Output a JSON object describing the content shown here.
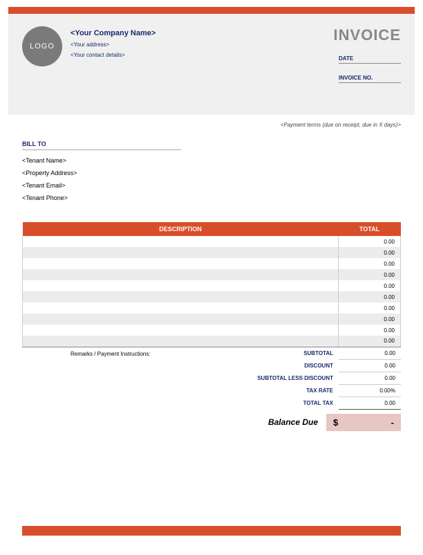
{
  "colors": {
    "accent": "#d94e2a",
    "dark_blue": "#172a6b",
    "balance_bg": "#e8c6c3"
  },
  "logo": {
    "text": "LOGO"
  },
  "company": {
    "name": "<Your Company Name>",
    "address": "<Your address>",
    "contact": "<Your contact details>"
  },
  "invoice": {
    "title": "INVOICE",
    "date_label": "DATE",
    "number_label": "INVOICE NO."
  },
  "payment_terms": "<Payment terms (due on receipt, due in X days)>",
  "bill_to": {
    "label": "BILL TO",
    "tenant_name": "<Tenant Name>",
    "property_address": "<Property Address>",
    "tenant_email": "<Tenant Email>",
    "tenant_phone": "<Tenant Phone>"
  },
  "table": {
    "headers": {
      "description": "DESCRIPTION",
      "total": "TOTAL"
    },
    "rows": [
      {
        "description": "",
        "total": "0.00"
      },
      {
        "description": "",
        "total": "0.00"
      },
      {
        "description": "",
        "total": "0.00"
      },
      {
        "description": "",
        "total": "0.00"
      },
      {
        "description": "",
        "total": "0.00"
      },
      {
        "description": "",
        "total": "0.00"
      },
      {
        "description": "",
        "total": "0.00"
      },
      {
        "description": "",
        "total": "0.00"
      },
      {
        "description": "",
        "total": "0.00"
      },
      {
        "description": "",
        "total": "0.00"
      }
    ]
  },
  "remarks_label": "Remarks / Payment Instructions:",
  "summary": {
    "subtotal": {
      "label": "SUBTOTAL",
      "value": "0.00"
    },
    "discount": {
      "label": "DISCOUNT",
      "value": "0.00"
    },
    "subtotal_less_discount": {
      "label": "SUBTOTAL LESS DISCOUNT",
      "value": "0.00"
    },
    "tax_rate": {
      "label": "TAX RATE",
      "value": "0.00%"
    },
    "total_tax": {
      "label": "TOTAL TAX",
      "value": "0.00"
    }
  },
  "balance": {
    "label": "Balance Due",
    "currency": "$",
    "value": "-"
  }
}
